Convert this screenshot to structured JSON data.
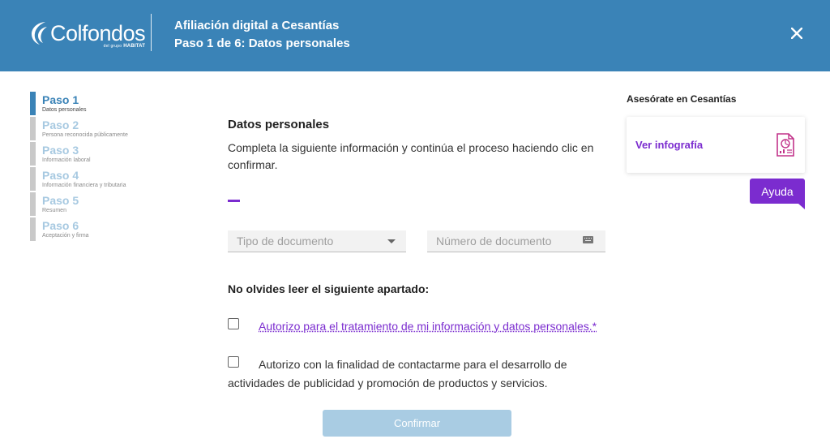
{
  "header": {
    "logo_text": "Colfondos",
    "logo_sub_small": "del grupo",
    "logo_sub_brand": "HABITAT",
    "title_line1": "Afiliación digital a Cesantías",
    "title_line2": "Paso 1 de 6: Datos personales",
    "close_icon": "close-icon"
  },
  "steps": [
    {
      "title": "Paso 1",
      "subtitle": "Datos personales",
      "active": true
    },
    {
      "title": "Paso 2",
      "subtitle": "Persona reconocida públicamente",
      "active": false
    },
    {
      "title": "Paso 3",
      "subtitle": "Información laboral",
      "active": false
    },
    {
      "title": "Paso 4",
      "subtitle": "Información financiera y tributaria",
      "active": false
    },
    {
      "title": "Paso 5",
      "subtitle": "Resumen",
      "active": false
    },
    {
      "title": "Paso 6",
      "subtitle": "Aceptación y firma",
      "active": false
    }
  ],
  "form": {
    "title": "Datos personales",
    "intro": "Completa la siguiente información y continúa el proceso haciendo clic en confirmar.",
    "doc_type_placeholder": "Tipo de documento",
    "doc_number_placeholder": "Número de documento",
    "reminder": "No olvides leer el siguiente apartado:",
    "consent_data": "Autorizo para el tratamiento de mi información y datos personales.*",
    "consent_marketing": "Autorizo con la finalidad de contactarme para el desarrollo de actividades de publicidad y promoción de productos y servicios.",
    "confirm_label": "Confirmar"
  },
  "sidebar": {
    "title": "Asesórate en Cesantías",
    "card_label": "Ver infografía",
    "help_label": "Ayuda"
  },
  "colors": {
    "brand_blue": "#3a83b7",
    "accent_purple": "#7b2ccf",
    "confirm_disabled": "#a9cce3"
  }
}
